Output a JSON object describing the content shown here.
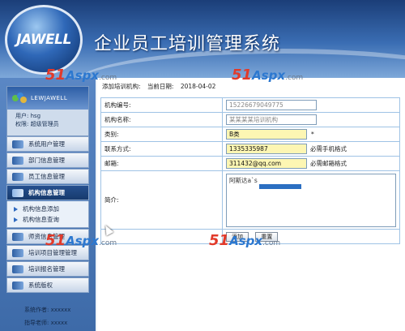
{
  "header": {
    "logo_text": "JAWELL",
    "app_title": "企业员工培训管理系统"
  },
  "watermark": {
    "num": "51",
    "aspx": "Aspx",
    "com": ".com"
  },
  "user": {
    "brand": "LEWJAWELL",
    "user_label": "用户: hsg",
    "role_label": "权限: 超级管理员"
  },
  "menu": {
    "items": [
      {
        "label": "系统用户管理"
      },
      {
        "label": "部门信息管理"
      },
      {
        "label": "员工信息管理"
      },
      {
        "label": "机构信息管理"
      }
    ],
    "sub_items": [
      {
        "label": "机构信息添加"
      },
      {
        "label": "机构信息查询"
      }
    ],
    "partial_item": "师资信息管理",
    "items_after": [
      {
        "label": "培训项目管理管理"
      },
      {
        "label": "培训报名管理"
      },
      {
        "label": "系统版权"
      }
    ]
  },
  "footer": {
    "author": "系统作者: xxxxxx",
    "teacher": "指导老师: xxxxx"
  },
  "breadcrumb": {
    "page": "添加培训机构:",
    "date_label": "当前日期:",
    "date": "2018-04-02"
  },
  "form": {
    "org_no": {
      "label": "机构编号:",
      "value": "15226679049775"
    },
    "org_name": {
      "label": "机构名称:",
      "value": "某某某某培训机构"
    },
    "category": {
      "label": "类别:",
      "value": "B类",
      "star": "*"
    },
    "contact": {
      "label": "联系方式:",
      "value": "1335335987",
      "hint": "必需手机格式"
    },
    "email": {
      "label": "邮箱:",
      "value": "311432@qq.com",
      "hint": "必需邮箱格式"
    },
    "intro": {
      "label": "简介:",
      "value": "阿斯达a`s"
    },
    "buttons": {
      "submit": "添加",
      "reset": "重置"
    }
  }
}
